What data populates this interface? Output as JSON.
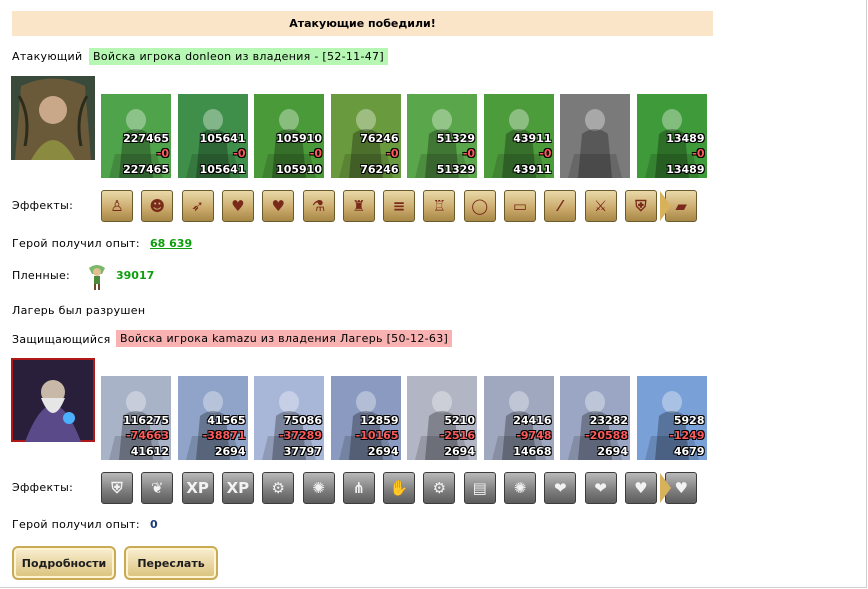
{
  "banner": "Атакующие победили!",
  "attacker": {
    "label": "Атакующий",
    "army": "Войска игрока donleon из владения - [52-11-47]",
    "units": [
      {
        "top": "227465",
        "mid": "-0",
        "bot": "227465",
        "color": "#4fa34a"
      },
      {
        "top": "105641",
        "mid": "-0",
        "bot": "105641",
        "color": "#3f8f4a"
      },
      {
        "top": "105910",
        "mid": "-0",
        "bot": "105910",
        "color": "#4a9a3a"
      },
      {
        "top": "76246",
        "mid": "-0",
        "bot": "76246",
        "color": "#6a9a3e"
      },
      {
        "top": "51329",
        "mid": "-0",
        "bot": "51329",
        "color": "#5aa64a"
      },
      {
        "top": "43911",
        "mid": "-0",
        "bot": "43911",
        "color": "#4d9c3c"
      },
      {
        "top": "",
        "mid": "",
        "bot": "",
        "color": "#7a7a7a"
      },
      {
        "top": "13489",
        "mid": "-0",
        "bot": "13489",
        "color": "#3f9a3a"
      }
    ],
    "effects_label": "Эффекты:",
    "effects": [
      "figure-icon",
      "mask-icon",
      "arrow-icon",
      "heart-icon",
      "heart-hand-icon",
      "potion-icon",
      "cloak-icon",
      "scroll-icon",
      "armor-icon",
      "ring-icon",
      "book-icon",
      "staff-icon",
      "sword-icon",
      "shield-icon",
      "gold-scroll-icon"
    ],
    "exp_label": "Герой получил опыт:",
    "exp_value": "68 639",
    "captives_label": "Пленные:",
    "captives_value": "39017",
    "camp_text": "Лагерь был разрушен"
  },
  "defender": {
    "label": "Защищающийся",
    "army": "Войска игрока kamazu из владения Лагерь [50-12-63]",
    "units": [
      {
        "top": "116275",
        "mid": "-74663",
        "bot": "41612",
        "color": "#a9b3c8"
      },
      {
        "top": "41565",
        "mid": "-38871",
        "bot": "2694",
        "color": "#8fa4c8"
      },
      {
        "top": "75086",
        "mid": "-37289",
        "bot": "37797",
        "color": "#a8b6d8"
      },
      {
        "top": "12859",
        "mid": "-10165",
        "bot": "2694",
        "color": "#8a9ac0"
      },
      {
        "top": "5210",
        "mid": "-2516",
        "bot": "2694",
        "color": "#b2b6c4"
      },
      {
        "top": "24416",
        "mid": "-9748",
        "bot": "14668",
        "color": "#a0a8c0"
      },
      {
        "top": "23282",
        "mid": "-20588",
        "bot": "2694",
        "color": "#9aa6c4"
      },
      {
        "top": "5928",
        "mid": "-1249",
        "bot": "4679",
        "color": "#7aa0d8"
      }
    ],
    "effects_label": "Эффекты:",
    "effects": [
      "shield-icon",
      "wings-icon",
      "xp-icon",
      "dragon-xp-icon",
      "gear-shield-icon",
      "burst-shield-icon",
      "claw-shield-icon",
      "hand-shield-icon",
      "gear-icon",
      "tablet-icon",
      "burst-icon",
      "claw-heart-icon",
      "hand-heart-icon",
      "xp-heart-icon",
      "heart-icon"
    ],
    "exp_label": "Герой получил опыт:",
    "exp_value": "0"
  },
  "buttons": {
    "details": "Подробности",
    "forward": "Переслать"
  }
}
